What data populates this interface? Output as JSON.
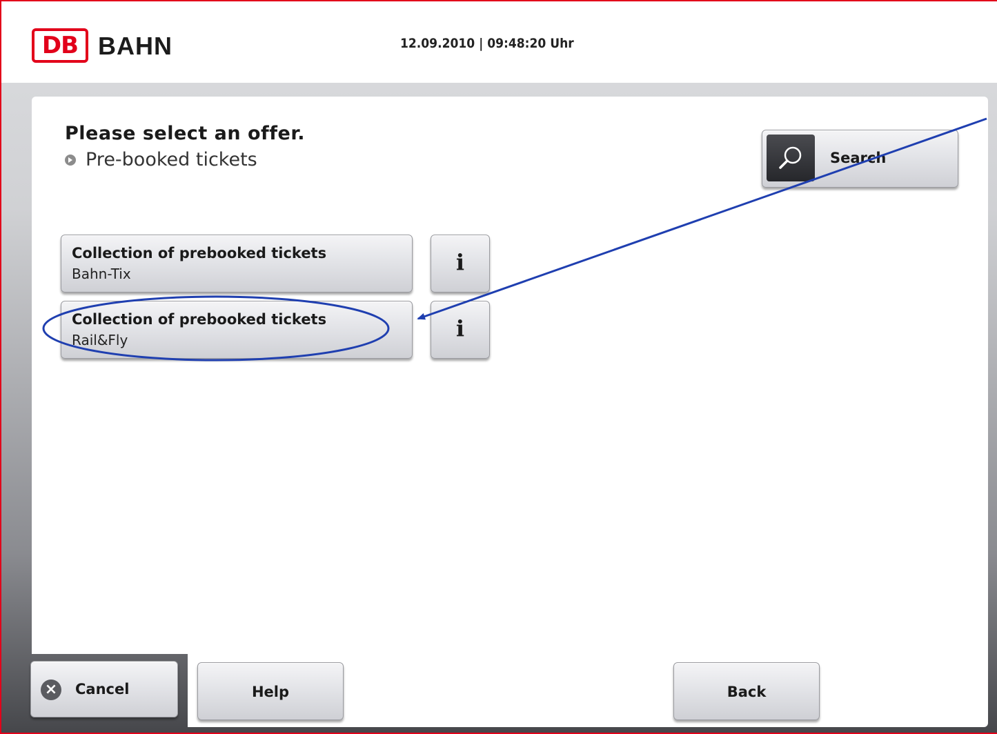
{
  "header": {
    "logo_text": "DB",
    "brand": "BAHN",
    "datetime": "12.09.2010 | 09:48:20 Uhr"
  },
  "main": {
    "title": "Please select an offer.",
    "subtitle": "Pre-booked tickets",
    "search_label": "Search",
    "offers": [
      {
        "title": "Collection of prebooked tickets",
        "subtitle": "Bahn-Tix",
        "info": "i"
      },
      {
        "title": "Collection of prebooked tickets",
        "subtitle": "Rail&Fly",
        "info": "i"
      }
    ]
  },
  "footer": {
    "cancel": "Cancel",
    "help": "Help",
    "back": "Back"
  },
  "colors": {
    "brand_red": "#e2001a",
    "annotation_blue": "#1f3fb0"
  },
  "icons": [
    "search-icon",
    "info-icon",
    "close-icon",
    "chevron-right-icon"
  ]
}
